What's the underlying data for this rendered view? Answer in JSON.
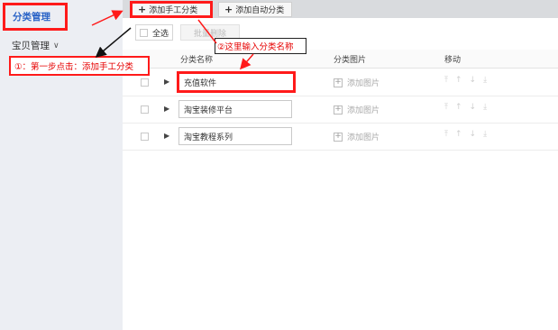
{
  "sidebar": {
    "category_manage": "分类管理",
    "goods_manage": "宝贝管理",
    "goods_chevron": "∨"
  },
  "toolbar": {
    "add_manual": "添加手工分类",
    "add_auto": "添加自动分类"
  },
  "subbar": {
    "select_all": "全选",
    "batch_delete": "批量删除"
  },
  "table": {
    "headers": {
      "name": "分类名称",
      "image": "分类图片",
      "move": "移动"
    },
    "rows": [
      {
        "name": "充值软件",
        "add_image": "添加图片"
      },
      {
        "name": "淘宝装修平台",
        "add_image": "添加图片"
      },
      {
        "name": "淘宝教程系列",
        "add_image": "添加图片"
      }
    ],
    "move_icons": [
      "move-top-icon",
      "move-up-icon",
      "move-down-icon",
      "move-bottom-icon"
    ]
  },
  "annotations": {
    "step1": "①：第一步点击：添加手工分类",
    "step2": "②这里输入分类名称"
  },
  "colors": {
    "highlight": "#ff1a1a",
    "annotation_text": "#e60000",
    "sidebar_bg": "#eceef3",
    "active_nav": "#2b64c7",
    "toolbar_bg": "#d9dbde"
  }
}
